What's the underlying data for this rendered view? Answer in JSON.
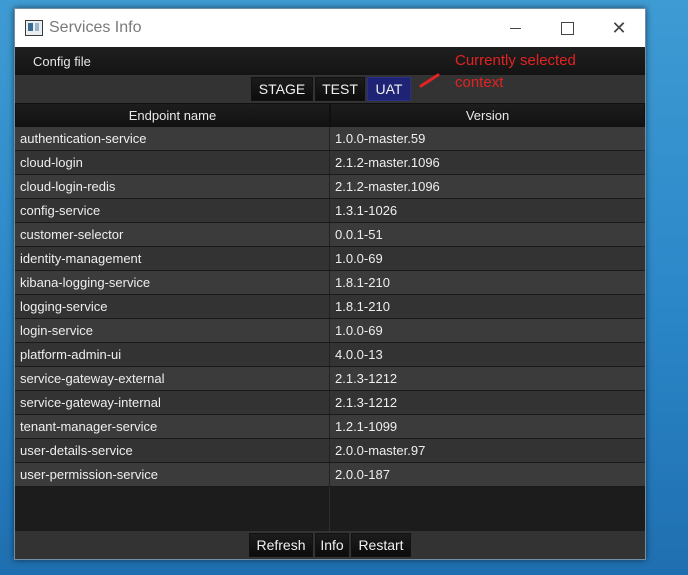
{
  "window": {
    "title": "Services Info"
  },
  "menu": {
    "config_file": "Config file"
  },
  "contexts": [
    {
      "label": "STAGE",
      "selected": false
    },
    {
      "label": "TEST",
      "selected": false
    },
    {
      "label": "UAT",
      "selected": true
    }
  ],
  "annotation": {
    "text": "Currently selected context",
    "color": "#e32222"
  },
  "table": {
    "headers": [
      "Endpoint name",
      "Version"
    ],
    "rows": [
      {
        "endpoint": "authentication-service",
        "version": "1.0.0-master.59"
      },
      {
        "endpoint": "cloud-login",
        "version": "2.1.2-master.1096"
      },
      {
        "endpoint": "cloud-login-redis",
        "version": "2.1.2-master.1096"
      },
      {
        "endpoint": "config-service",
        "version": "1.3.1-1026"
      },
      {
        "endpoint": "customer-selector",
        "version": "0.0.1-51"
      },
      {
        "endpoint": "identity-management",
        "version": "1.0.0-69"
      },
      {
        "endpoint": "kibana-logging-service",
        "version": "1.8.1-210"
      },
      {
        "endpoint": "logging-service",
        "version": "1.8.1-210"
      },
      {
        "endpoint": "login-service",
        "version": "1.0.0-69"
      },
      {
        "endpoint": "platform-admin-ui",
        "version": "4.0.0-13"
      },
      {
        "endpoint": "service-gateway-external",
        "version": "2.1.3-1212"
      },
      {
        "endpoint": "service-gateway-internal",
        "version": "2.1.3-1212"
      },
      {
        "endpoint": "tenant-manager-service",
        "version": "1.2.1-1099"
      },
      {
        "endpoint": "user-details-service",
        "version": "2.0.0-master.97"
      },
      {
        "endpoint": "user-permission-service",
        "version": "2.0.0-187"
      }
    ]
  },
  "actions": {
    "refresh": "Refresh",
    "info": "Info",
    "restart": "Restart"
  },
  "colors": {
    "selected_context": "#1f2375",
    "background": "#2c2c2c"
  }
}
